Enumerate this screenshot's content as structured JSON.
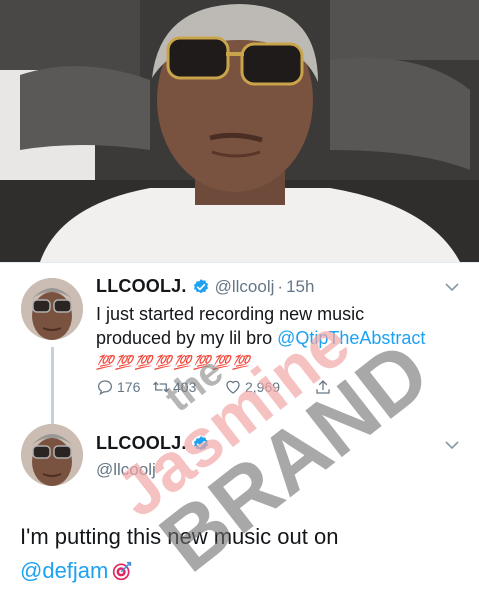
{
  "tweet1": {
    "name": "LLCOOLJ.",
    "handle": "@llcoolj",
    "dot": "·",
    "time": "15h",
    "text_line1": "I just  started recording  new music",
    "text_line2_prefix": "produced by my lil bro ",
    "mention": "@QtipTheAbstract",
    "emoji_line": "💯💯💯💯💯💯💯💯",
    "replies": "176",
    "retweets": "403",
    "likes": "2,969"
  },
  "tweet2": {
    "name": "LLCOOLJ.",
    "handle": "@llcoolj",
    "text_line1": "I'm putting this new music out on",
    "mention": "@defjam"
  },
  "watermark": {
    "line1": "the",
    "line2": "Jasmine",
    "line3": "BRAND"
  },
  "colors": {
    "link": "#1da1f2",
    "secondary_text": "#657786",
    "verified": "#1da1f2",
    "hundred_emoji": "#d4281e"
  },
  "icons": [
    "verified-badge-icon",
    "chevron-down-icon",
    "reply-icon",
    "retweet-icon",
    "like-icon",
    "share-icon",
    "direct-hit-icon"
  ]
}
